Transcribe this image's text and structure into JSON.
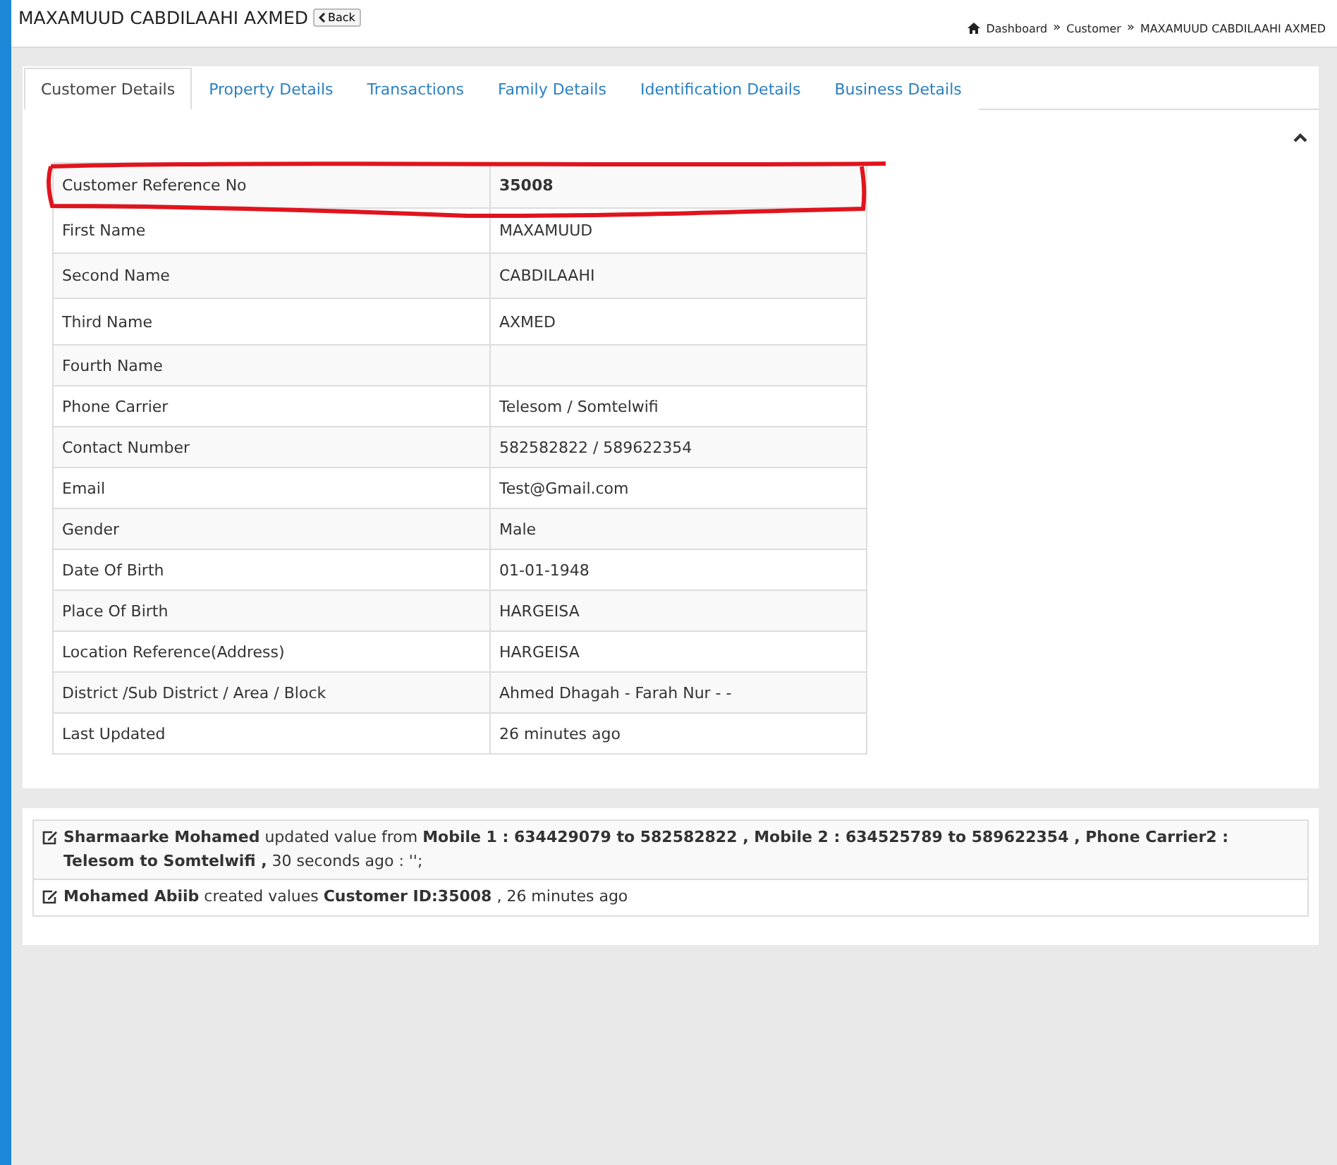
{
  "header": {
    "title": "MAXAMUUD CABDILAAHI AXMED",
    "back_button": "Back",
    "breadcrumb": [
      "Dashboard",
      "Customer",
      "MAXAMUUD CABDILAAHI AXMED"
    ],
    "breadcrumb_separators": [
      "»",
      "»"
    ]
  },
  "tabs": [
    {
      "label": "Customer Details",
      "selected": true
    },
    {
      "label": "Property Details",
      "selected": false
    },
    {
      "label": "Transactions",
      "selected": false
    },
    {
      "label": "Family Details",
      "selected": false
    },
    {
      "label": "Identification Details",
      "selected": false
    },
    {
      "label": "Business Details",
      "selected": false
    }
  ],
  "details": [
    {
      "label": "Customer Reference No",
      "value": "35008",
      "highlighted": true
    },
    {
      "label": "First Name",
      "value": "MAXAMUUD",
      "highlighted": false
    },
    {
      "label": "Second Name",
      "value": "CABDILAAHI",
      "highlighted": false
    },
    {
      "label": "Third Name",
      "value": "AXMED",
      "highlighted": false
    },
    {
      "label": "Fourth Name",
      "highlighted": false
    },
    {
      "label": "Phone Carrier",
      "value": "Telesom / Somtelwifi",
      "highlighted": false
    },
    {
      "label": "Contact Number",
      "value": "582582822 / 589622354",
      "highlighted": false
    },
    {
      "label": "Email",
      "value": "Test@Gmail.com",
      "highlighted": false
    },
    {
      "label": "Gender",
      "value": "Male",
      "highlighted": false
    },
    {
      "label": "Date Of Birth",
      "value": "01-01-1948",
      "highlighted": false
    },
    {
      "label": "Place Of Birth",
      "value": "HARGEISA",
      "highlighted": false
    },
    {
      "label": "Location Reference(Address)",
      "value": "HARGEISA",
      "highlighted": false
    },
    {
      "label": "District /Sub District / Area / Block",
      "value": "Ahmed Dhagah - Farah Nur - -",
      "highlighted": false
    },
    {
      "label": "Last Updated",
      "value": "26 minutes ago",
      "highlighted": false
    }
  ],
  "activity_log": [
    "**Sharmaarke Mohamed** updated value from **Mobile 1 : 634429079 to 582582822 , Mobile 2 : 634525789 to 589622354 , Phone Carrier2 : Telesom to Somtelwifi ,** 30 seconds ago : '';",
    "**Mohamed Abiib** created values **Customer ID:35008** , 26 minutes ago"
  ]
}
